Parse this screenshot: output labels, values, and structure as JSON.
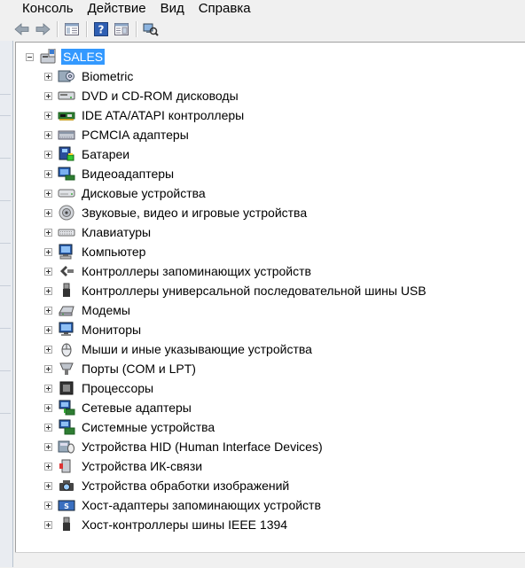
{
  "menu": [
    "Консоль",
    "Действие",
    "Вид",
    "Справка"
  ],
  "toolbar": {
    "buttons": [
      "back-icon",
      "forward-icon",
      "console-tree-icon",
      "help-icon",
      "properties-icon",
      "scan-hardware-icon"
    ]
  },
  "tree": {
    "root": "SALES",
    "items": [
      {
        "label": "Biometric",
        "icon": "biometric-icon"
      },
      {
        "label": "DVD и CD-ROM дисководы",
        "icon": "dvd-drive-icon"
      },
      {
        "label": "IDE ATA/ATAPI контроллеры",
        "icon": "ide-controller-icon"
      },
      {
        "label": "PCMCIA адаптеры",
        "icon": "pcmcia-icon"
      },
      {
        "label": "Батареи",
        "icon": "battery-icon"
      },
      {
        "label": "Видеоадаптеры",
        "icon": "display-adapter-icon"
      },
      {
        "label": "Дисковые устройства",
        "icon": "disk-drive-icon"
      },
      {
        "label": "Звуковые, видео и игровые устройства",
        "icon": "sound-icon"
      },
      {
        "label": "Клавиатуры",
        "icon": "keyboard-icon"
      },
      {
        "label": "Компьютер",
        "icon": "computer-icon"
      },
      {
        "label": "Контроллеры запоминающих устройств",
        "icon": "storage-controller-icon"
      },
      {
        "label": "Контроллеры универсальной последовательной шины USB",
        "icon": "usb-icon"
      },
      {
        "label": "Модемы",
        "icon": "modem-icon"
      },
      {
        "label": "Мониторы",
        "icon": "monitor-icon"
      },
      {
        "label": "Мыши и иные указывающие устройства",
        "icon": "mouse-icon"
      },
      {
        "label": "Порты (COM и LPT)",
        "icon": "port-icon"
      },
      {
        "label": "Процессоры",
        "icon": "processor-icon"
      },
      {
        "label": "Сетевые адаптеры",
        "icon": "network-adapter-icon"
      },
      {
        "label": "Системные устройства",
        "icon": "system-device-icon"
      },
      {
        "label": "Устройства HID (Human Interface Devices)",
        "icon": "hid-icon"
      },
      {
        "label": "Устройства ИК-связи",
        "icon": "infrared-icon"
      },
      {
        "label": "Устройства обработки изображений",
        "icon": "imaging-device-icon"
      },
      {
        "label": "Хост-адаптеры запоминающих устройств",
        "icon": "storage-host-adapter-icon"
      },
      {
        "label": "Хост-контроллеры шины IEEE 1394",
        "icon": "ieee1394-icon"
      }
    ]
  },
  "colors": {
    "selection": "#3399ff",
    "window_bg": "#f0f0f0",
    "tree_bg": "#ffffff"
  }
}
